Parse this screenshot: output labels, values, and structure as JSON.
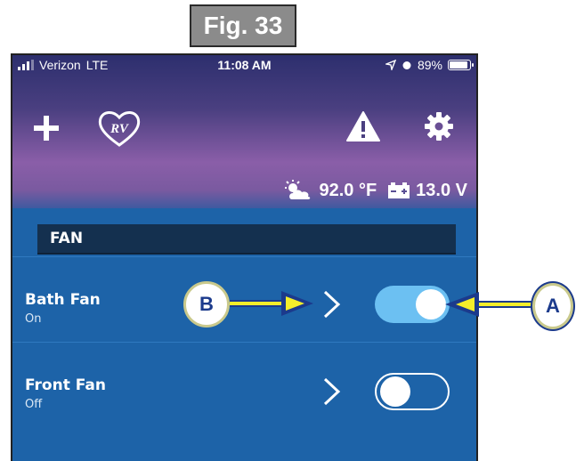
{
  "figure": {
    "label": "Fig. 33"
  },
  "status_bar": {
    "carrier": "Verizon",
    "network": "LTE",
    "time": "11:08 AM",
    "battery": "89%",
    "battery_level": 0.89
  },
  "header": {
    "add_icon": "plus-icon",
    "logo_text": "RV",
    "alert_icon": "warning-icon",
    "settings_icon": "gear-icon"
  },
  "readouts": {
    "temperature": "92.0 °F",
    "voltage": "13.0 V"
  },
  "section": {
    "title": "FAN"
  },
  "fans": [
    {
      "name": "Bath Fan",
      "state": "On",
      "toggle_on": true
    },
    {
      "name": "Front Fan",
      "state": "Off",
      "toggle_on": false
    }
  ],
  "callouts": {
    "a": "A",
    "b": "B"
  },
  "colors": {
    "accent_blue": "#1d63a8",
    "toggle_on": "#6cc0f2",
    "callout_yellow": "#f4ee2a",
    "callout_text": "#1b3a8c"
  }
}
